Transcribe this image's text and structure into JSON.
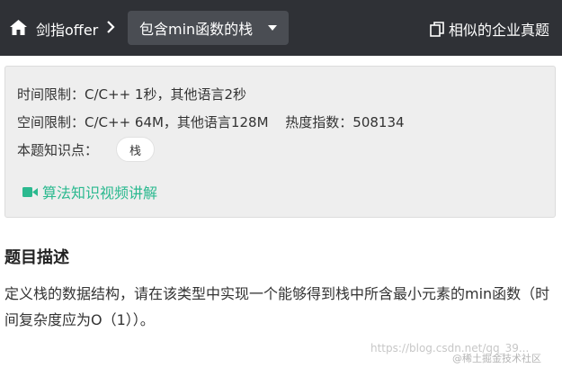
{
  "header": {
    "breadcrumb_root": "剑指offer",
    "current_problem": "包含min函数的栈",
    "similar_link": "相似的企业真题"
  },
  "info": {
    "time_limit": "时间限制：C/C++ 1秒，其他语言2秒",
    "space_limit": "空间限制：C/C++ 64M，其他语言128M",
    "heat": "热度指数：508134",
    "knowledge_label": "本题知识点：",
    "tag": "栈",
    "video_link": "算法知识视频讲解"
  },
  "description": {
    "title": "题目描述",
    "text": "定义栈的数据结构，请在该类型中实现一个能够得到栈中所含最小元素的min函数（时间复杂度应为O（1））。"
  },
  "watermarks": {
    "url": "https://blog.csdn.net/qq_39...",
    "community": "@稀土掘金技术社区"
  },
  "colors": {
    "topbar": "#2f3136",
    "select_bg": "#4a4d53",
    "accent_green": "#2bb98f",
    "panel_bg": "#eeeeee"
  },
  "icons": {
    "home": "home-icon",
    "separator": "chevron-right-icon",
    "dropdown": "caret-down-icon",
    "similar": "copy-icon",
    "video": "video-camera-icon"
  }
}
